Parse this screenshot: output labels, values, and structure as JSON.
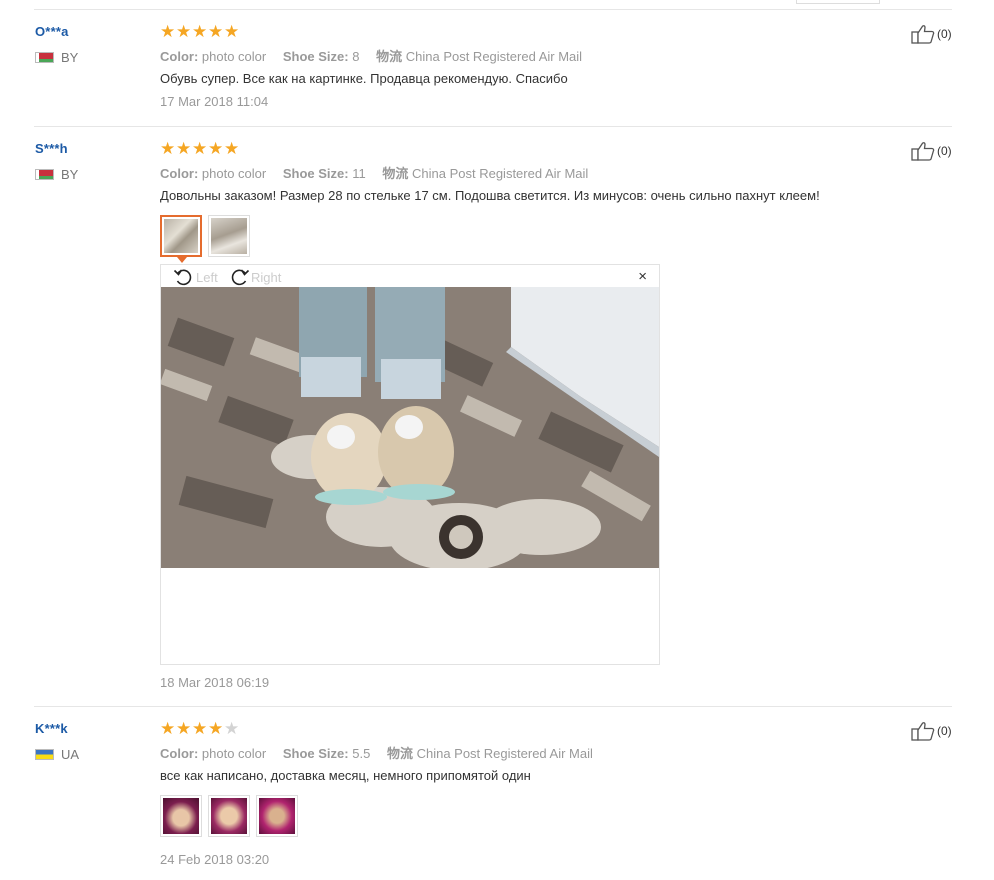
{
  "labels": {
    "color": "Color:",
    "shoe_size": "Shoe Size:",
    "shipping": "物流",
    "rotate_left": "Left",
    "rotate_right": "Right",
    "close": "×"
  },
  "reviews": [
    {
      "user": "O***a",
      "country": "BY",
      "rating": 5,
      "color": "photo color",
      "shoe_size": "8",
      "shipping": "China Post Registered Air Mail",
      "text": "Обувь супер. Все как на картинке. Продавца рекомендую. Спасибо",
      "date": "17 Mar 2018 11:04",
      "helpful": "(0)"
    },
    {
      "user": "S***h",
      "country": "BY",
      "rating": 5,
      "color": "photo color",
      "shoe_size": "11",
      "shipping": "China Post Registered Air Mail",
      "text": "Довольны заказом! Размер 28 по стельке 17 см. Подошва светится. Из минусов: очень сильно пахнут клеем!",
      "date": "18 Mar 2018 06:19",
      "helpful": "(0)",
      "photo_count": 2
    },
    {
      "user": "K***k",
      "country": "UA",
      "rating": 4,
      "color": "photo color",
      "shoe_size": "5.5",
      "shipping": "China Post Registered Air Mail",
      "text": "все как написано, доставка месяц, немного припомятой один",
      "date": "24 Feb 2018 03:20",
      "helpful": "(0)",
      "photo_count": 3
    }
  ],
  "colors": {
    "username": "#1c5aa6",
    "star_on": "#f5a623",
    "star_off": "#d3d3d3",
    "thumb_active_border": "#e56c2e",
    "muted_text": "#999999"
  }
}
